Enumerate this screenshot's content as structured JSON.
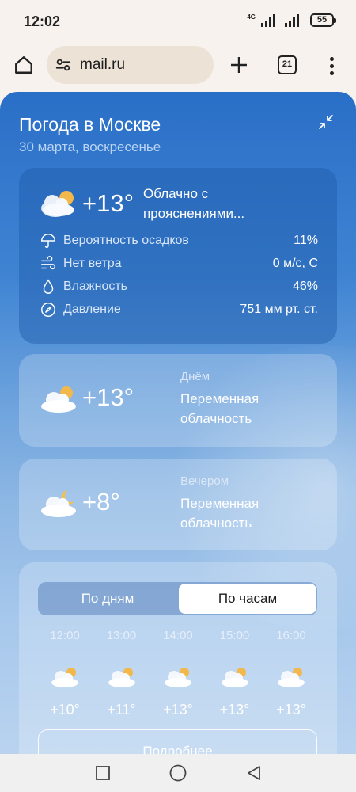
{
  "status_bar": {
    "time": "12:02",
    "network": "4G",
    "battery": "55"
  },
  "browser": {
    "url": "mail.ru",
    "tab_count": "21",
    "icons": [
      "home-icon",
      "site-settings-icon",
      "plus-icon",
      "tabs-icon",
      "more-vert-icon"
    ]
  },
  "weather": {
    "title": "Погода в Москве",
    "date": "30 марта, воскресенье",
    "now": {
      "temp": "+13°",
      "condition": "Облачно с прояснениями...",
      "details": [
        {
          "icon": "umbrella-icon",
          "label": "Вероятность осадков",
          "value": "11%"
        },
        {
          "icon": "wind-icon",
          "label": "Нет ветра",
          "value": "0 м/с, С"
        },
        {
          "icon": "humidity-icon",
          "label": "Влажность",
          "value": "46%"
        },
        {
          "icon": "pressure-icon",
          "label": "Давление",
          "value": "751 мм рт. ст."
        }
      ]
    },
    "day": {
      "label": "Днём",
      "temp": "+13°",
      "condition": "Переменная облачность"
    },
    "evening": {
      "label": "Вечером",
      "temp": "+8°",
      "condition": "Переменная облачность"
    },
    "forecast": {
      "tabs": [
        "По дням",
        "По часам"
      ],
      "selected_tab": "По часам",
      "hours": [
        {
          "time": "12:00",
          "temp": "+10°"
        },
        {
          "time": "13:00",
          "temp": "+11°"
        },
        {
          "time": "14:00",
          "temp": "+13°"
        },
        {
          "time": "15:00",
          "temp": "+13°"
        },
        {
          "time": "16:00",
          "temp": "+13°"
        }
      ],
      "more_label": "Подробнее"
    }
  },
  "colors": {
    "panel_top": "#2a6fc7",
    "panel_bottom": "#b9d3ef",
    "chrome_bg": "#f7f2ee",
    "url_bar_bg": "#ede2d6"
  }
}
